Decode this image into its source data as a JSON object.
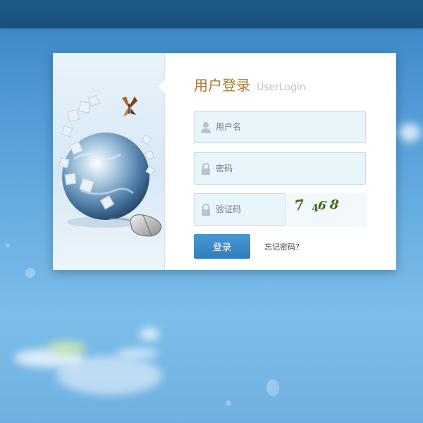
{
  "login": {
    "title_cn": "用户登录",
    "title_en": "UserLogin",
    "username": {
      "value": "",
      "placeholder": "用户名"
    },
    "password": {
      "value": "",
      "placeholder": "密码"
    },
    "captcha": {
      "value": "",
      "placeholder": "验证码",
      "image_text": "7468"
    },
    "submit_label": "登录",
    "forgot_label": "忘记密码？"
  },
  "icons": {
    "username": "user-icon",
    "password": "lock-icon",
    "captcha": "lock-icon",
    "illustration": "globe-puzzle-mouse-butterfly"
  },
  "colors": {
    "topbar": "#1d5682",
    "title": "#a87a2d",
    "button": "#3a8ac6",
    "field_bg": "#eaf4fb"
  }
}
